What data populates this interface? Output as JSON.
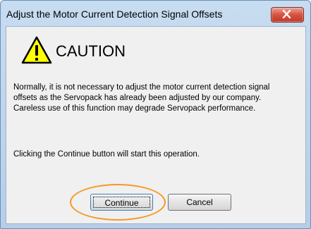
{
  "window": {
    "title": "Adjust the Motor Current Detection Signal Offsets",
    "close_icon": "close-icon"
  },
  "caution": {
    "icon": "warning-triangle-icon",
    "label": "CAUTION"
  },
  "message": {
    "lines": [
      "Normally, it is not necessary to adjust the motor current detection signal",
      "offsets as the Servopack has already been adjusted by our company.",
      "Careless use of this function may degrade Servopack performance."
    ],
    "continue_note": "Clicking the Continue button will start this operation."
  },
  "buttons": {
    "continue_label": "Continue",
    "cancel_label": "Cancel"
  },
  "colors": {
    "highlight": "#f39a27",
    "close_button": "#c3382a",
    "title_bar": "#c7dcf1"
  }
}
